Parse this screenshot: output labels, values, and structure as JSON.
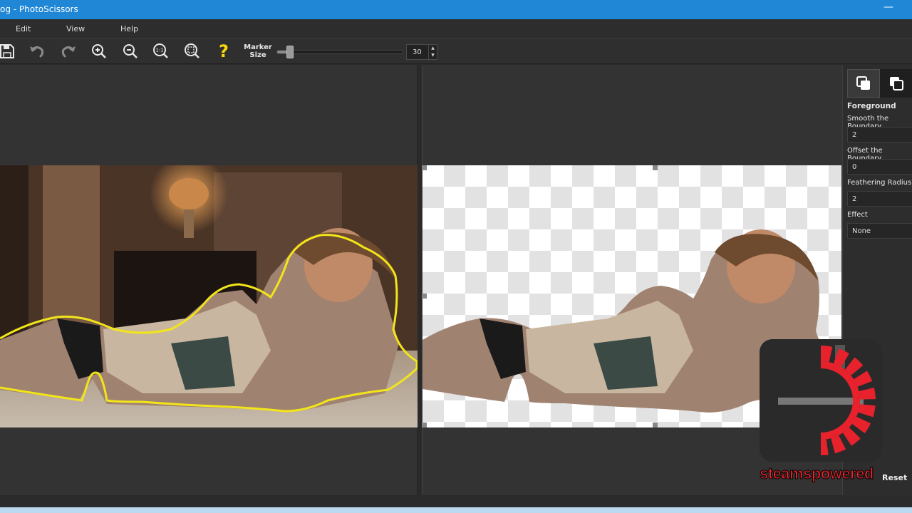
{
  "window": {
    "title": "og - PhotoScissors",
    "minimize_glyph": "—"
  },
  "menu": {
    "edit": "Edit",
    "view": "View",
    "help": "Help"
  },
  "toolbar": {
    "buttons": [
      "save-icon",
      "undo-icon",
      "redo-icon",
      "zoom-in-icon",
      "zoom-out-icon",
      "actual-size-icon",
      "fit-window-icon",
      "help-icon"
    ],
    "actual_size_text": "1:1",
    "help_glyph": "?",
    "marker_label_line1": "Marker",
    "marker_label_line2": "Size",
    "marker_size": "30",
    "marker_slider_fraction": 0.1
  },
  "side_panel": {
    "tabs": [
      "foreground-tab-icon",
      "background-tab-icon"
    ],
    "section_title": "Foreground",
    "smooth_label": "Smooth the Boundary",
    "smooth_value": "2",
    "offset_label": "Offset the Boundary",
    "offset_value": "0",
    "feather_label": "Feathering Radius",
    "feather_value": "2",
    "effect_label": "Effect",
    "effect_value": "None",
    "reset_label": "Reset"
  },
  "watermark": {
    "text": "steamspowered"
  },
  "colors": {
    "accent": "#1f87d6",
    "selection_outline": "#f2e51a",
    "watermark_red": "#e8222c"
  }
}
